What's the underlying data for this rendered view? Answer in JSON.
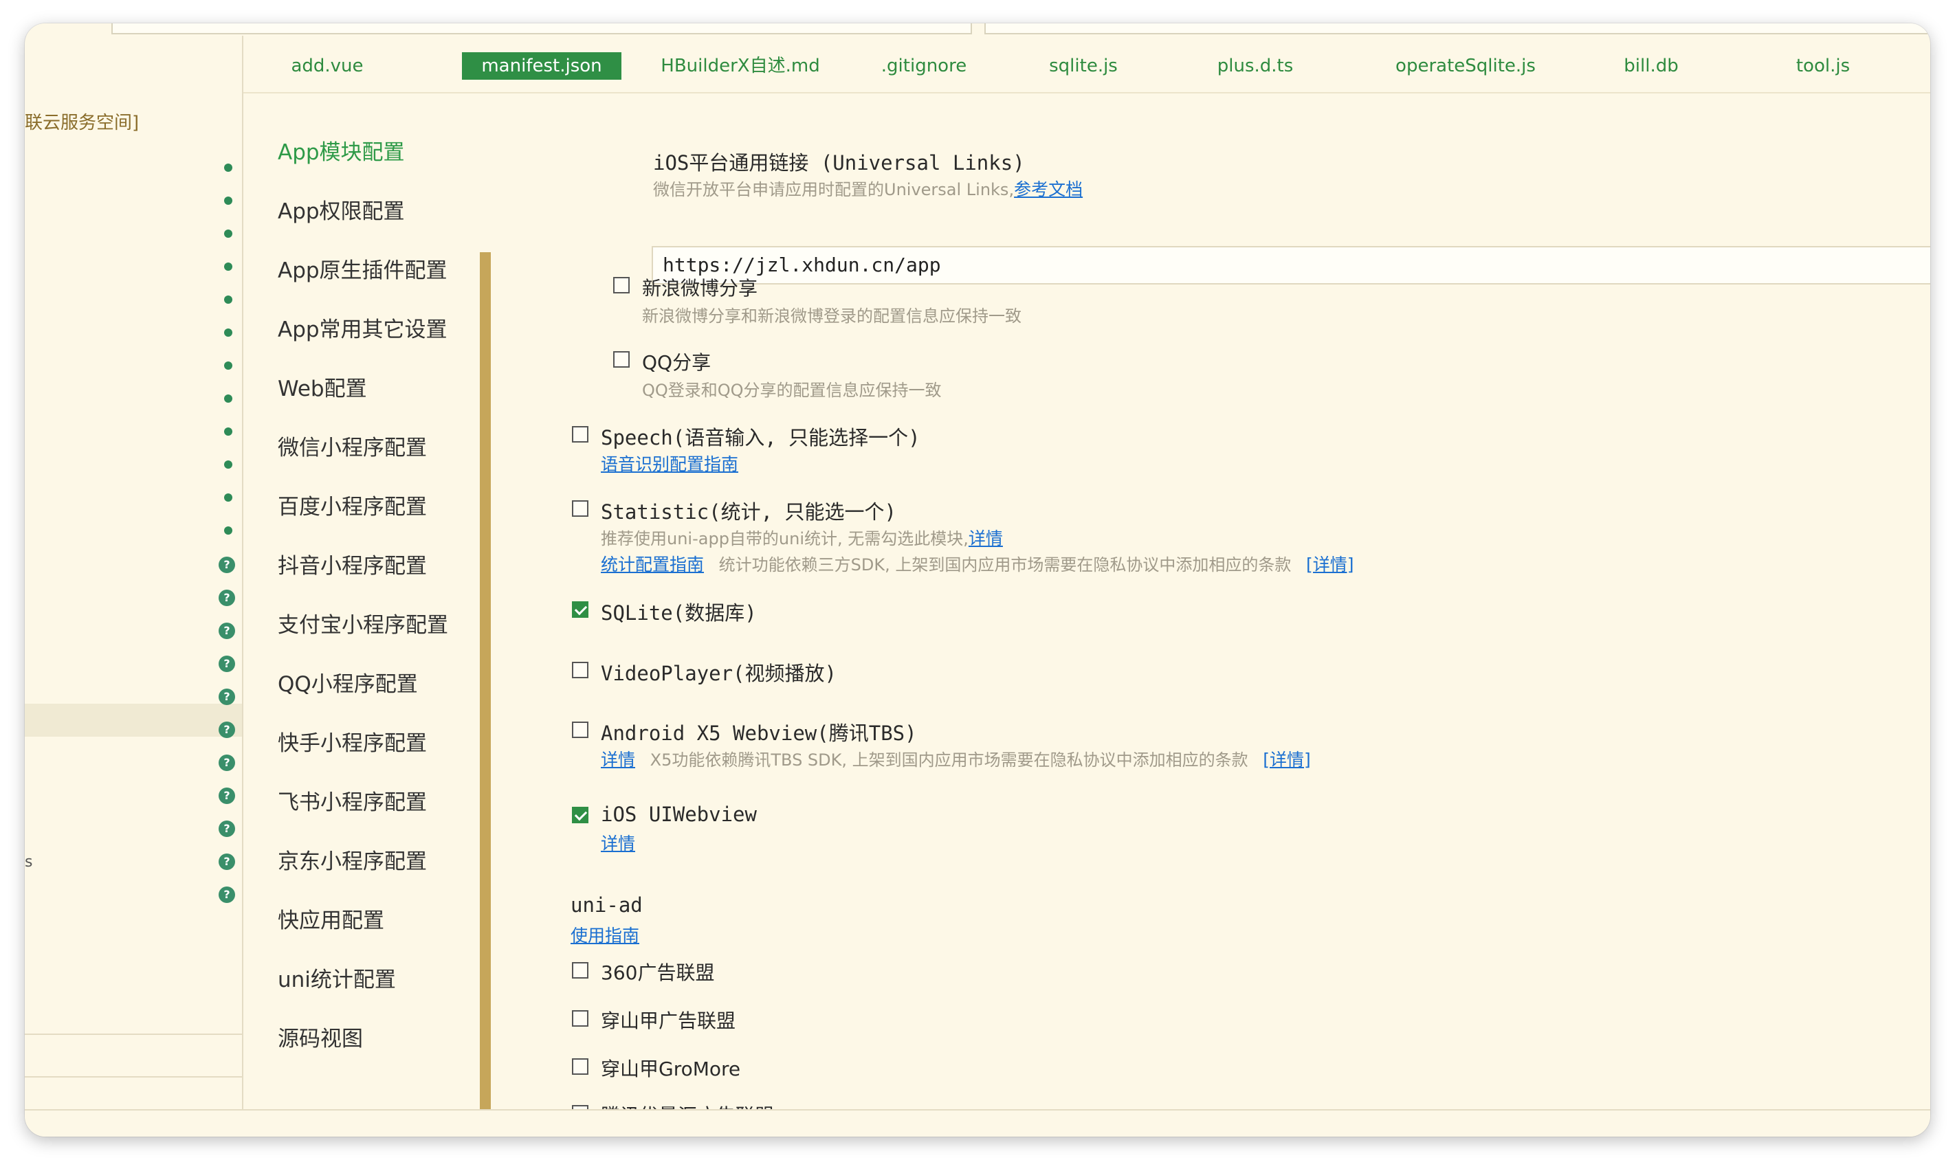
{
  "tree": {
    "root_label": "联云服务空间]",
    "side_mark": "s"
  },
  "tabs": [
    {
      "label": "add.vue"
    },
    {
      "label": "manifest.json"
    },
    {
      "label": "HBuilderX自述.md"
    },
    {
      "label": ".gitignore"
    },
    {
      "label": "sqlite.js"
    },
    {
      "label": "plus.d.ts"
    },
    {
      "label": "operateSqlite.js"
    },
    {
      "label": "bill.db"
    },
    {
      "label": "tool.js"
    }
  ],
  "active_tab": "manifest.json",
  "nav": {
    "items": [
      "App模块配置",
      "App权限配置",
      "App原生插件配置",
      "App常用其它设置",
      "Web配置",
      "微信小程序配置",
      "百度小程序配置",
      "抖音小程序配置",
      "支付宝小程序配置",
      "QQ小程序配置",
      "快手小程序配置",
      "飞书小程序配置",
      "京东小程序配置",
      "快应用配置",
      "uni统计配置",
      "源码视图"
    ],
    "active": "App模块配置"
  },
  "content": {
    "universal_links": {
      "title": "iOS平台通用链接 (Universal Links)",
      "desc": "微信开放平台申请应用时配置的Universal Links,",
      "link": "参考文档",
      "value": "https://jzl.xhdun.cn/app"
    },
    "weibo": {
      "label": "新浪微博分享",
      "desc": "新浪微博分享和新浪微博登录的配置信息应保持一致",
      "checked": false
    },
    "qq": {
      "label": "QQ分享",
      "desc": "QQ登录和QQ分享的配置信息应保持一致",
      "checked": false
    },
    "speech": {
      "label": "Speech(语音输入, 只能选择一个)",
      "link": "语音识别配置指南",
      "checked": false
    },
    "statistic": {
      "label": "Statistic(统计, 只能选一个)",
      "desc": "推荐使用uni-app自带的uni统计, 无需勾选此模块,",
      "desc_link": "详情",
      "link2": "统计配置指南",
      "desc2": "统计功能依赖三方SDK, 上架到国内应用市场需要在隐私协议中添加相应的条款",
      "detail": "[详情]",
      "checked": false
    },
    "sqlite": {
      "label": "SQLite(数据库)",
      "checked": true
    },
    "videoplayer": {
      "label": "VideoPlayer(视频播放)",
      "checked": false
    },
    "x5": {
      "label": "Android X5 Webview(腾讯TBS)",
      "link": "详情",
      "desc": "X5功能依赖腾讯TBS SDK, 上架到国内应用市场需要在隐私协议中添加相应的条款",
      "detail": "[详情]",
      "checked": false
    },
    "uiwebview": {
      "label": "iOS UIWebview",
      "link": "详情",
      "checked": true
    },
    "uniad": {
      "title": "uni-ad",
      "link": "使用指南",
      "items": [
        {
          "label": "360广告联盟",
          "checked": false
        },
        {
          "label": "穿山甲广告联盟",
          "checked": false
        },
        {
          "label": "穿山甲GroMore",
          "checked": false
        },
        {
          "label": "腾讯优量汇广告联盟",
          "checked": false
        }
      ]
    }
  }
}
